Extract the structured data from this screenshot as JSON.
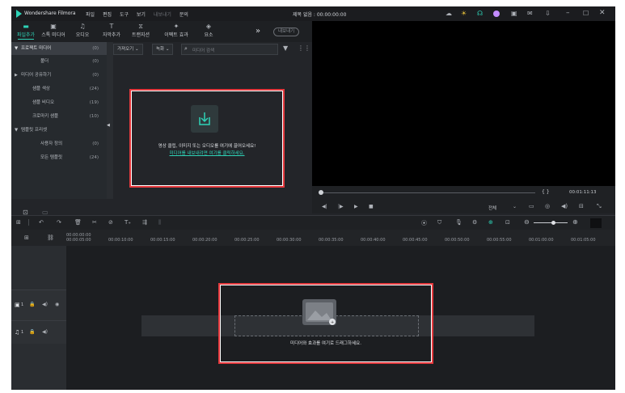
{
  "titlebar": {
    "app_name": "Wondershare Filmora",
    "menus": [
      "파일",
      "편집",
      "도구",
      "보기",
      "내보내기",
      "문의"
    ],
    "project_title": "제목 없음 : 00:00:00:00",
    "window_icons": [
      "cloud-icon",
      "sun-icon",
      "headset-icon",
      "avatar-icon",
      "save-icon",
      "mail-icon",
      "download-icon"
    ]
  },
  "toolbar": {
    "tabs": [
      {
        "label": "파일추가",
        "icon": "folder-icon"
      },
      {
        "label": "스톡 미디어",
        "icon": "stock-icon"
      },
      {
        "label": "오디오",
        "icon": "music-icon"
      },
      {
        "label": "자막추가",
        "icon": "text-icon"
      },
      {
        "label": "트랜지션",
        "icon": "transition-icon"
      },
      {
        "label": "이펙트 효과",
        "icon": "effects-icon"
      },
      {
        "label": "요소",
        "icon": "elements-icon"
      }
    ],
    "more": "»",
    "export_label": "내보내기"
  },
  "sidebar": {
    "items": [
      {
        "label": "프로젝트 미디어",
        "count": "(0)",
        "arrow": "▼"
      },
      {
        "label": "폴더",
        "count": "(0)",
        "arrow": ""
      },
      {
        "label": "미디어 공유하기",
        "count": "(0)",
        "arrow": "▶"
      },
      {
        "label": "샘플 색상",
        "count": "(24)",
        "arrow": ""
      },
      {
        "label": "샘플 비디오",
        "count": "(19)",
        "arrow": ""
      },
      {
        "label": "크로마키 샘플",
        "count": "(10)",
        "arrow": ""
      },
      {
        "label": "템플릿 프리셋",
        "count": "",
        "arrow": "▼"
      },
      {
        "label": "사용자 정의",
        "count": "(0)",
        "arrow": ""
      },
      {
        "label": "모든 템플릿",
        "count": "(24)",
        "arrow": ""
      }
    ]
  },
  "media": {
    "import_label": "가져오기",
    "record_label": "녹화",
    "search_placeholder": "미디어 검색",
    "drop_text": "영상 클립, 이미지 또는 오디오를 여기에 끌어오세요!",
    "drop_link": "미디어를 내보내려면 여기를 클릭하세요."
  },
  "preview": {
    "braces": "{  }",
    "timecode": "00:01:11:13",
    "quality": "전체"
  },
  "timeline": {
    "ruler_ticks": [
      "00:00:00:00",
      "00:00:05:00",
      "00:00:10:00",
      "00:00:15:00",
      "00:00:20:00",
      "00:00:25:00",
      "00:00:30:00",
      "00:00:35:00",
      "00:00:40:00",
      "00:00:45:00",
      "00:00:50:00",
      "00:00:55:00",
      "00:01:00:00",
      "00:01:05:00"
    ],
    "drop_text": "미디어와 효과를 여기로 드래그하세요.",
    "video_track": "1",
    "audio_track": "1"
  }
}
